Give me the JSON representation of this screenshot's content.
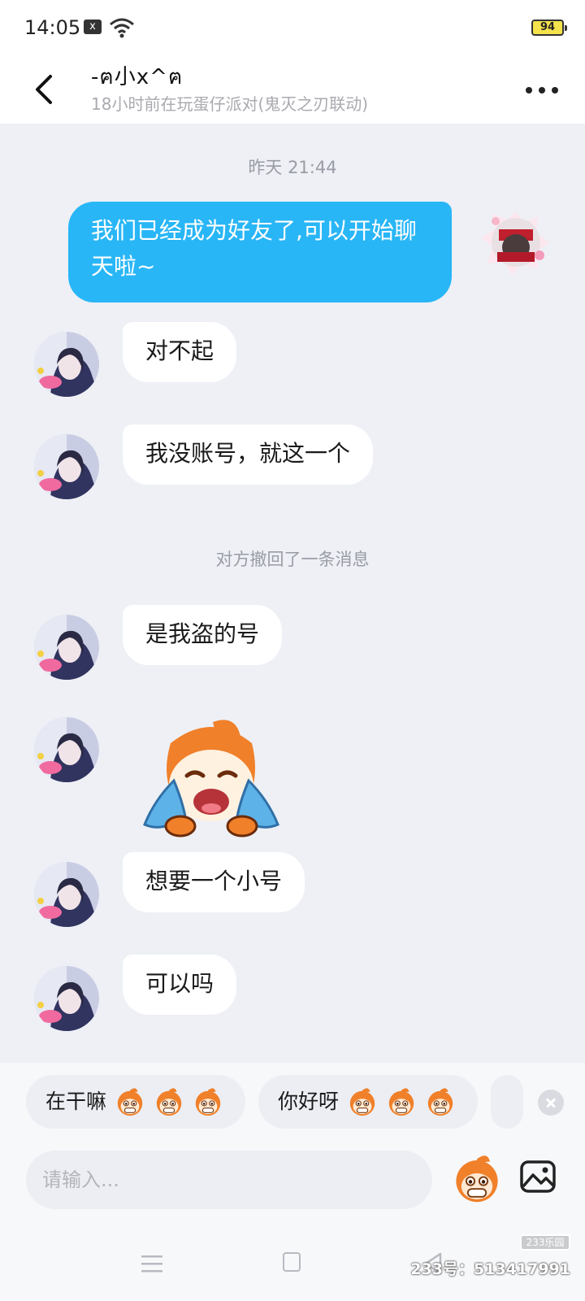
{
  "status_bar": {
    "time": "14:05",
    "notification": "x",
    "battery": "94"
  },
  "header": {
    "contact_name": "-ฅ小x^ฅ",
    "presence": "18小时前在玩蛋仔派对(鬼灭之刃联动)"
  },
  "messages": {
    "timestamp": "昨天 21:44",
    "me_1": "我们已经成为好友了,可以开始聊天啦~",
    "them_1": "对不起",
    "them_2": "我没账号，就这一个",
    "recall_notice": "对方撤回了一条消息",
    "them_3": "是我盗的号",
    "them_4": "想要一个小号",
    "them_5": "可以吗"
  },
  "quick_replies": [
    {
      "label": "在干嘛"
    },
    {
      "label": "你好呀"
    }
  ],
  "input": {
    "placeholder": "请输入..."
  },
  "watermark": {
    "logo": "233乐园",
    "id": "233号：513417991"
  },
  "colors": {
    "accent": "#29b6f6",
    "background": "#eef0f6",
    "sticker_orange": "#f0802a"
  },
  "icons": [
    "back-arrow-icon",
    "more-dots-icon",
    "wifi-icon",
    "emoji-icon",
    "image-icon",
    "close-icon"
  ]
}
